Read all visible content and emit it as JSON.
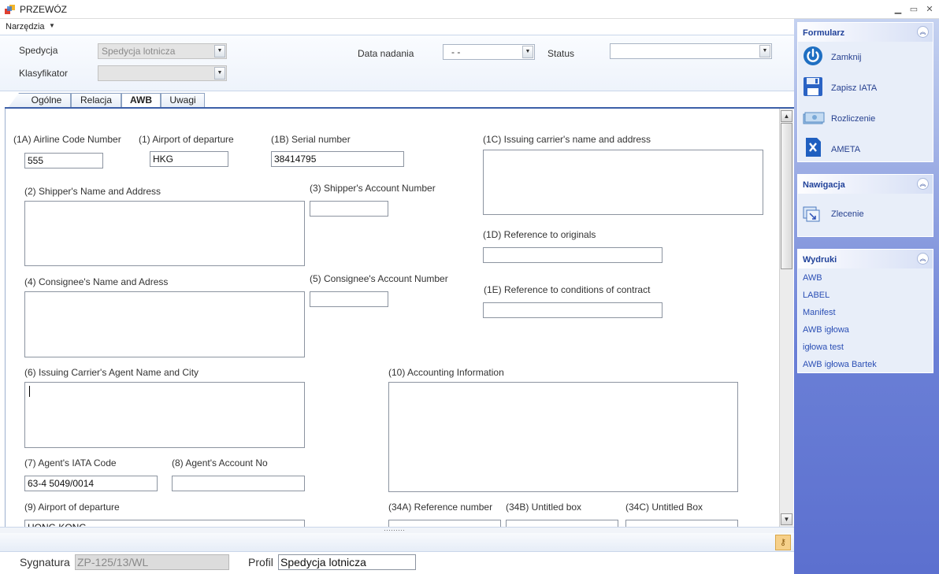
{
  "window": {
    "title": "PRZEWÓZ"
  },
  "menu": {
    "tools": "Narzędzia"
  },
  "header": {
    "spedycja_label": "Spedycja",
    "spedycja_value": "Spedycja lotnicza",
    "klasyfikator_label": "Klasyfikator",
    "klasyfikator_value": "",
    "data_nadania_label": "Data nadania",
    "data_nadania_value": "-  -",
    "status_label": "Status",
    "status_value": ""
  },
  "tabs": [
    {
      "label": "Ogólne"
    },
    {
      "label": "Relacja"
    },
    {
      "label": "AWB"
    },
    {
      "label": "Uwagi"
    }
  ],
  "awb": {
    "airline_code_label": "(1A) Airline Code Number",
    "airline_code_value": "555",
    "airport_departure_label": "(1) Airport of departure",
    "airport_departure_value": "HKG",
    "serial_label": "(1B) Serial number",
    "serial_value": "38414795",
    "issuing_carrier_label": "(1C) Issuing carrier's name and address",
    "shipper_label": "(2) Shipper's Name and Address",
    "shipper_account_label": "(3) Shipper's Account Number",
    "reference_originals_label": "(1D) Reference to originals",
    "consignee_label": "(4) Consignee's Name and Adress",
    "consignee_account_label": "(5) Consignee's Account Number",
    "reference_conditions_label": "(1E) Reference to conditions of contract",
    "agent_name_label": "(6) Issuing Carrier's Agent Name and City",
    "accounting_label": "(10) Accounting Information",
    "agent_iata_label": "(7) Agent's IATA Code",
    "agent_iata_value": "63-4 5049/0014",
    "agent_account_label": "(8) Agent's Account No",
    "airport_departure2_label": "(9) Airport of departure",
    "airport_departure2_value": "HONG KONG",
    "reference_number_label": "(34A) Reference number",
    "untitled_box_b_label": "(34B) Untitled box",
    "untitled_box_c_label": "(34C) Untitled Box"
  },
  "status": {
    "sygnatura_label": "Sygnatura",
    "sygnatura_value": "ZP-125/13/WL",
    "profil_label": "Profil",
    "profil_value": "Spedycja lotnicza"
  },
  "sidebar": {
    "formularz": {
      "title": "Formularz",
      "items": [
        {
          "label": "Zamknij",
          "icon": "power-icon"
        },
        {
          "label": "Zapisz IATA",
          "icon": "floppy-icon"
        },
        {
          "label": "Rozliczenie",
          "icon": "money-icon"
        },
        {
          "label": "AMETA",
          "icon": "ameta-icon"
        }
      ]
    },
    "nawigacja": {
      "title": "Nawigacja",
      "items": [
        {
          "label": "Zlecenie",
          "icon": "order-icon"
        }
      ]
    },
    "wydruki": {
      "title": "Wydruki",
      "items": [
        {
          "label": "AWB"
        },
        {
          "label": "LABEL"
        },
        {
          "label": "Manifest"
        },
        {
          "label": "AWB igłowa"
        },
        {
          "label": "igłowa test"
        },
        {
          "label": "AWB igłowa Bartek"
        }
      ]
    }
  },
  "colors": {
    "sidebar_top": "#c5d2f0",
    "sidebar_bottom": "#5c70cf",
    "tab_accent": "#3c5fa8",
    "link": "#2b4fb5"
  }
}
